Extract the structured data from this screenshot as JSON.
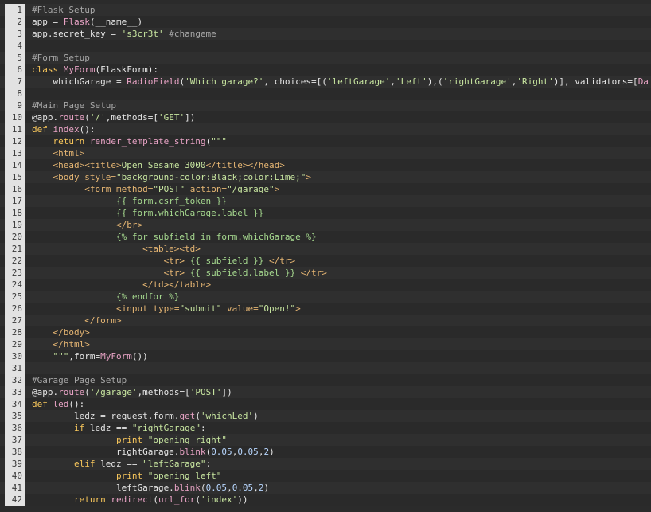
{
  "colors": {
    "plain": "#e6e6e6",
    "keyword": "#f7c65b",
    "builtin": "#e8a3c5",
    "string": "#c8e6a0",
    "comment": "#a8a8a8",
    "tag": "#e6b673",
    "number": "#b8d7ff",
    "attr": "#e6b673",
    "template": "#a6d98f"
  },
  "lines": [
    {
      "num": "1",
      "tokens": [
        {
          "t": "#Flask Setup",
          "c": "comment"
        }
      ]
    },
    {
      "num": "2",
      "tokens": [
        {
          "t": "app = ",
          "c": "plain"
        },
        {
          "t": "Flask",
          "c": "builtin"
        },
        {
          "t": "(__name__)",
          "c": "plain"
        }
      ]
    },
    {
      "num": "3",
      "tokens": [
        {
          "t": "app.secret_key = ",
          "c": "plain"
        },
        {
          "t": "'s3cr3t'",
          "c": "string"
        },
        {
          "t": " #changeme",
          "c": "comment"
        }
      ]
    },
    {
      "num": "4",
      "tokens": []
    },
    {
      "num": "5",
      "tokens": [
        {
          "t": "#Form Setup",
          "c": "comment"
        }
      ]
    },
    {
      "num": "6",
      "tokens": [
        {
          "t": "class ",
          "c": "keyword"
        },
        {
          "t": "MyForm",
          "c": "builtin"
        },
        {
          "t": "(FlaskForm):",
          "c": "plain"
        }
      ]
    },
    {
      "num": "7",
      "tokens": [
        {
          "t": "    whichGarage = ",
          "c": "plain"
        },
        {
          "t": "RadioField",
          "c": "builtin"
        },
        {
          "t": "(",
          "c": "plain"
        },
        {
          "t": "'Which garage?'",
          "c": "string"
        },
        {
          "t": ", choices=[(",
          "c": "plain"
        },
        {
          "t": "'leftGarage'",
          "c": "string"
        },
        {
          "t": ",",
          "c": "plain"
        },
        {
          "t": "'Left'",
          "c": "string"
        },
        {
          "t": "),(",
          "c": "plain"
        },
        {
          "t": "'rightGarage'",
          "c": "string"
        },
        {
          "t": ",",
          "c": "plain"
        },
        {
          "t": "'Right'",
          "c": "string"
        },
        {
          "t": ")], validators=[",
          "c": "plain"
        },
        {
          "t": "Da",
          "c": "builtin"
        }
      ]
    },
    {
      "num": "8",
      "tokens": []
    },
    {
      "num": "9",
      "tokens": [
        {
          "t": "#Main Page Setup",
          "c": "comment"
        }
      ]
    },
    {
      "num": "10",
      "tokens": [
        {
          "t": "@app.",
          "c": "plain"
        },
        {
          "t": "route",
          "c": "builtin"
        },
        {
          "t": "(",
          "c": "plain"
        },
        {
          "t": "'/'",
          "c": "string"
        },
        {
          "t": ",methods=[",
          "c": "plain"
        },
        {
          "t": "'GET'",
          "c": "string"
        },
        {
          "t": "])",
          "c": "plain"
        }
      ]
    },
    {
      "num": "11",
      "tokens": [
        {
          "t": "def ",
          "c": "keyword"
        },
        {
          "t": "index",
          "c": "builtin"
        },
        {
          "t": "():",
          "c": "plain"
        }
      ]
    },
    {
      "num": "12",
      "tokens": [
        {
          "t": "    return ",
          "c": "keyword"
        },
        {
          "t": "render_template_string",
          "c": "builtin"
        },
        {
          "t": "(",
          "c": "plain"
        },
        {
          "t": "\"\"\"",
          "c": "string"
        }
      ]
    },
    {
      "num": "13",
      "tokens": [
        {
          "t": "    <html>",
          "c": "tag"
        }
      ]
    },
    {
      "num": "14",
      "tokens": [
        {
          "t": "    <head><title>",
          "c": "tag"
        },
        {
          "t": "Open Sesame 3000",
          "c": "string"
        },
        {
          "t": "</title></head>",
          "c": "tag"
        }
      ]
    },
    {
      "num": "15",
      "tokens": [
        {
          "t": "    <body ",
          "c": "tag"
        },
        {
          "t": "style=",
          "c": "attr"
        },
        {
          "t": "\"background-color:Black;color:Lime;\"",
          "c": "string"
        },
        {
          "t": ">",
          "c": "tag"
        }
      ]
    },
    {
      "num": "16",
      "tokens": [
        {
          "t": "          <form ",
          "c": "tag"
        },
        {
          "t": "method=",
          "c": "attr"
        },
        {
          "t": "\"POST\"",
          "c": "string"
        },
        {
          "t": " action=",
          "c": "attr"
        },
        {
          "t": "\"/garage\"",
          "c": "string"
        },
        {
          "t": ">",
          "c": "tag"
        }
      ]
    },
    {
      "num": "17",
      "tokens": [
        {
          "t": "                {{ form.csrf_token }}",
          "c": "template"
        }
      ]
    },
    {
      "num": "18",
      "tokens": [
        {
          "t": "                {{ form.whichGarage.label }}",
          "c": "template"
        }
      ]
    },
    {
      "num": "19",
      "tokens": [
        {
          "t": "                </br>",
          "c": "tag"
        }
      ]
    },
    {
      "num": "20",
      "tokens": [
        {
          "t": "                {% for subfield in form.whichGarage %}",
          "c": "template"
        }
      ]
    },
    {
      "num": "21",
      "tokens": [
        {
          "t": "                     <table><td>",
          "c": "tag"
        }
      ]
    },
    {
      "num": "22",
      "tokens": [
        {
          "t": "                         <tr> ",
          "c": "tag"
        },
        {
          "t": "{{ subfield }}",
          "c": "template"
        },
        {
          "t": " </tr>",
          "c": "tag"
        }
      ]
    },
    {
      "num": "23",
      "tokens": [
        {
          "t": "                         <tr> ",
          "c": "tag"
        },
        {
          "t": "{{ subfield.label }}",
          "c": "template"
        },
        {
          "t": " </tr>",
          "c": "tag"
        }
      ]
    },
    {
      "num": "24",
      "tokens": [
        {
          "t": "                     </td></table>",
          "c": "tag"
        }
      ]
    },
    {
      "num": "25",
      "tokens": [
        {
          "t": "                {% endfor %}",
          "c": "template"
        }
      ]
    },
    {
      "num": "26",
      "tokens": [
        {
          "t": "                <input ",
          "c": "tag"
        },
        {
          "t": "type=",
          "c": "attr"
        },
        {
          "t": "\"submit\"",
          "c": "string"
        },
        {
          "t": " value=",
          "c": "attr"
        },
        {
          "t": "\"Open!\"",
          "c": "string"
        },
        {
          "t": ">",
          "c": "tag"
        }
      ]
    },
    {
      "num": "27",
      "tokens": [
        {
          "t": "          </form>",
          "c": "tag"
        }
      ]
    },
    {
      "num": "28",
      "tokens": [
        {
          "t": "    </body>",
          "c": "tag"
        }
      ]
    },
    {
      "num": "29",
      "tokens": [
        {
          "t": "    </html>",
          "c": "tag"
        }
      ]
    },
    {
      "num": "30",
      "tokens": [
        {
          "t": "    \"\"\"",
          "c": "string"
        },
        {
          "t": ",form=",
          "c": "plain"
        },
        {
          "t": "MyForm",
          "c": "builtin"
        },
        {
          "t": "())",
          "c": "plain"
        }
      ]
    },
    {
      "num": "31",
      "tokens": []
    },
    {
      "num": "32",
      "tokens": [
        {
          "t": "#Garage Page Setup",
          "c": "comment"
        }
      ]
    },
    {
      "num": "33",
      "tokens": [
        {
          "t": "@app.",
          "c": "plain"
        },
        {
          "t": "route",
          "c": "builtin"
        },
        {
          "t": "(",
          "c": "plain"
        },
        {
          "t": "'/garage'",
          "c": "string"
        },
        {
          "t": ",methods=[",
          "c": "plain"
        },
        {
          "t": "'POST'",
          "c": "string"
        },
        {
          "t": "])",
          "c": "plain"
        }
      ]
    },
    {
      "num": "34",
      "tokens": [
        {
          "t": "def ",
          "c": "keyword"
        },
        {
          "t": "led",
          "c": "builtin"
        },
        {
          "t": "():",
          "c": "plain"
        }
      ]
    },
    {
      "num": "35",
      "tokens": [
        {
          "t": "        ledz = request.form.",
          "c": "plain"
        },
        {
          "t": "get",
          "c": "builtin"
        },
        {
          "t": "(",
          "c": "plain"
        },
        {
          "t": "'whichLed'",
          "c": "string"
        },
        {
          "t": ")",
          "c": "plain"
        }
      ]
    },
    {
      "num": "36",
      "tokens": [
        {
          "t": "        if ",
          "c": "keyword"
        },
        {
          "t": "ledz == ",
          "c": "plain"
        },
        {
          "t": "\"rightGarage\"",
          "c": "string"
        },
        {
          "t": ":",
          "c": "plain"
        }
      ]
    },
    {
      "num": "37",
      "tokens": [
        {
          "t": "                print ",
          "c": "keyword"
        },
        {
          "t": "\"opening right\"",
          "c": "string"
        }
      ]
    },
    {
      "num": "38",
      "tokens": [
        {
          "t": "                rightGarage.",
          "c": "plain"
        },
        {
          "t": "blink",
          "c": "builtin"
        },
        {
          "t": "(",
          "c": "plain"
        },
        {
          "t": "0.05",
          "c": "number"
        },
        {
          "t": ",",
          "c": "plain"
        },
        {
          "t": "0.05",
          "c": "number"
        },
        {
          "t": ",",
          "c": "plain"
        },
        {
          "t": "2",
          "c": "number"
        },
        {
          "t": ")",
          "c": "plain"
        }
      ]
    },
    {
      "num": "39",
      "tokens": [
        {
          "t": "        elif ",
          "c": "keyword"
        },
        {
          "t": "ledz == ",
          "c": "plain"
        },
        {
          "t": "\"leftGarage\"",
          "c": "string"
        },
        {
          "t": ":",
          "c": "plain"
        }
      ]
    },
    {
      "num": "40",
      "tokens": [
        {
          "t": "                print ",
          "c": "keyword"
        },
        {
          "t": "\"opening left\"",
          "c": "string"
        }
      ]
    },
    {
      "num": "41",
      "tokens": [
        {
          "t": "                leftGarage.",
          "c": "plain"
        },
        {
          "t": "blink",
          "c": "builtin"
        },
        {
          "t": "(",
          "c": "plain"
        },
        {
          "t": "0.05",
          "c": "number"
        },
        {
          "t": ",",
          "c": "plain"
        },
        {
          "t": "0.05",
          "c": "number"
        },
        {
          "t": ",",
          "c": "plain"
        },
        {
          "t": "2",
          "c": "number"
        },
        {
          "t": ")",
          "c": "plain"
        }
      ]
    },
    {
      "num": "42",
      "tokens": [
        {
          "t": "        return ",
          "c": "keyword"
        },
        {
          "t": "redirect",
          "c": "builtin"
        },
        {
          "t": "(",
          "c": "plain"
        },
        {
          "t": "url_for",
          "c": "builtin"
        },
        {
          "t": "(",
          "c": "plain"
        },
        {
          "t": "'index'",
          "c": "string"
        },
        {
          "t": "))",
          "c": "plain"
        }
      ]
    }
  ]
}
